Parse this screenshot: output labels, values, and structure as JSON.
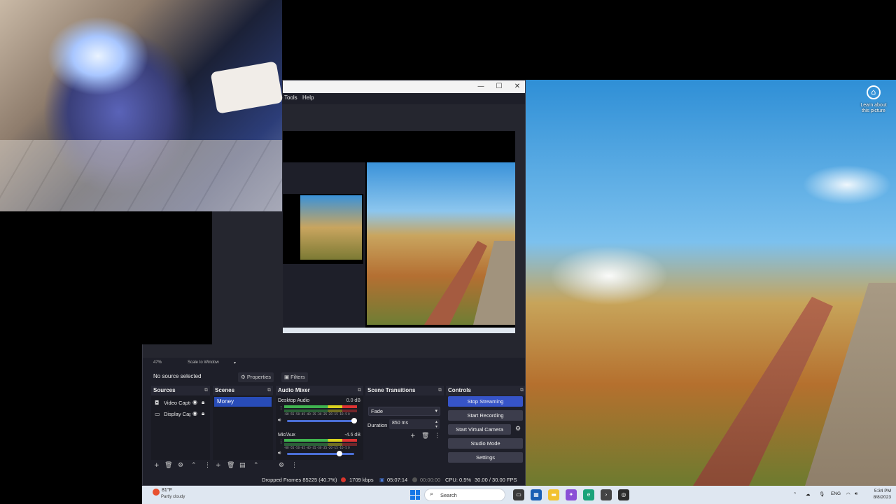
{
  "obs": {
    "menu": {
      "tools": "Tools",
      "help": "Help"
    },
    "window_controls": {
      "minimize": "—",
      "maximize": "☐",
      "close": "✕"
    },
    "preview_bar": {
      "zoom": "47%",
      "scale_label": "Scale to Window"
    },
    "toolbar": {
      "no_source": "No source selected",
      "properties": "Properties",
      "filters": "Filters"
    },
    "sources": {
      "title": "Sources",
      "items": [
        {
          "label": "Video Capture Device",
          "icon": "camera-icon"
        },
        {
          "label": "Display Capture",
          "icon": "monitor-icon"
        }
      ]
    },
    "scenes": {
      "title": "Scenes",
      "items": [
        {
          "label": "Money"
        }
      ]
    },
    "mixer": {
      "title": "Audio Mixer",
      "channels": [
        {
          "name": "Desktop Audio",
          "db": "0.0 dB",
          "scale": "-60 -55 -50 -45 -40 -35 -30 -25 -20 -15 -10 -5 0",
          "volume": 1.0
        },
        {
          "name": "Mic/Aux",
          "db": "-4.6 dB",
          "scale": "-60 -55 -50 -45 -40 -35 -30 -25 -20 -15 -10 -5 0",
          "volume": 0.78
        }
      ]
    },
    "transitions": {
      "title": "Scene Transitions",
      "type": "Fade",
      "duration_label": "Duration",
      "duration_value": "850 ms"
    },
    "controls": {
      "title": "Controls",
      "stop_streaming": "Stop Streaming",
      "start_recording": "Start Recording",
      "start_virtual_camera": "Start Virtual Camera",
      "studio_mode": "Studio Mode",
      "settings": "Settings"
    },
    "status": {
      "dropped_frames": "Dropped Frames 85225 (40.7%)",
      "bitrate": "1709 kbps",
      "stream_time": "05:07:14",
      "record_time": "00:00:00",
      "cpu": "CPU: 0.5%",
      "fps": "30.00 / 30.00 FPS"
    }
  },
  "desktop": {
    "learn_about": "Learn about this picture"
  },
  "taskbar": {
    "weather_temp": "81°F",
    "weather_desc": "Partly cloudy",
    "search_placeholder": "Search",
    "tray_lang": "ENG",
    "time": "5:34 PM",
    "date": "8/8/2023"
  },
  "colors": {
    "accent": "#3654c8",
    "obs_bg": "#1e1f29",
    "scene_selected": "#284cb8"
  }
}
